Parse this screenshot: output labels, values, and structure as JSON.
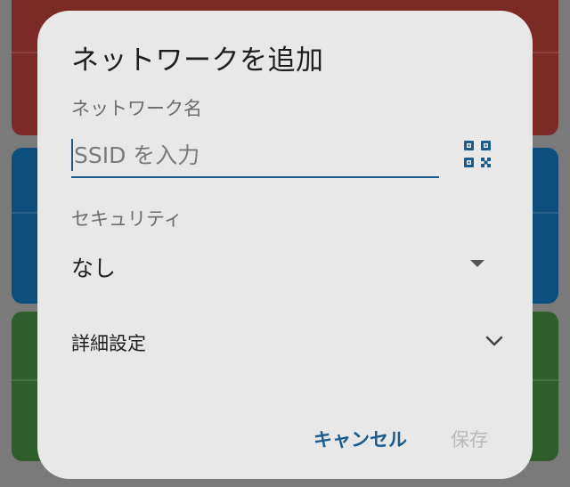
{
  "background": {
    "card1_colors": "#7c2a26",
    "card2_colors": "#0d4f7c",
    "card3_colors": "#2f5e2c"
  },
  "dialog": {
    "title": "ネットワークを追加",
    "network_name_label": "ネットワーク名",
    "ssid_placeholder": "SSID を入力",
    "ssid_value": "",
    "qr_icon": "qr-code-scan-icon",
    "security_label": "セキュリティ",
    "security_value": "なし",
    "advanced_label": "詳細設定",
    "cancel_label": "キャンセル",
    "save_label": "保存",
    "accent_color": "#1d5b8c"
  }
}
